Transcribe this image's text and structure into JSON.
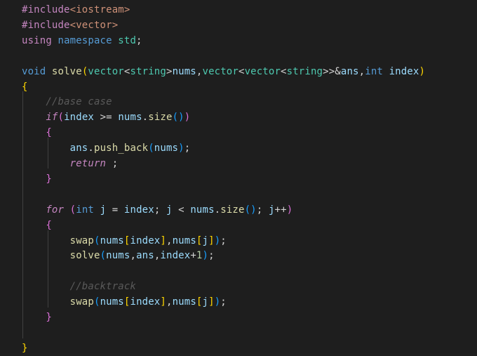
{
  "colors": {
    "background": "#1e1e1e",
    "keyword": "#c586c0",
    "type": "#569cd6",
    "control": "#c586c0",
    "function": "#dcdcaa",
    "variable": "#9cdcfe",
    "comment": "#6a9955",
    "default": "#d4d4d4"
  },
  "lines": [
    [
      {
        "t": "#include",
        "c": "#c586c0"
      },
      {
        "t": "<iostream>",
        "c": "#ce9178"
      }
    ],
    [
      {
        "t": "#include",
        "c": "#c586c0"
      },
      {
        "t": "<vector>",
        "c": "#ce9178"
      }
    ],
    [
      {
        "t": "using ",
        "c": "#c586c0"
      },
      {
        "t": "namespace ",
        "c": "#569cd6"
      },
      {
        "t": "std",
        "c": "#4ec9b0"
      },
      {
        "t": ";",
        "c": "#d4d4d4"
      }
    ],
    [],
    [
      {
        "t": "void ",
        "c": "#569cd6"
      },
      {
        "t": "solve",
        "c": "#dcdcaa"
      },
      {
        "t": "(",
        "c": "#ffd700"
      },
      {
        "t": "vector",
        "c": "#4ec9b0"
      },
      {
        "t": "<",
        "c": "#d4d4d4"
      },
      {
        "t": "string",
        "c": "#4ec9b0"
      },
      {
        "t": ">",
        "c": "#d4d4d4"
      },
      {
        "t": "nums",
        "c": "#9cdcfe"
      },
      {
        "t": ",",
        "c": "#d4d4d4"
      },
      {
        "t": "vector",
        "c": "#4ec9b0"
      },
      {
        "t": "<",
        "c": "#d4d4d4"
      },
      {
        "t": "vector",
        "c": "#4ec9b0"
      },
      {
        "t": "<",
        "c": "#d4d4d4"
      },
      {
        "t": "string",
        "c": "#4ec9b0"
      },
      {
        "t": ">>",
        "c": "#d4d4d4"
      },
      {
        "t": "&",
        "c": "#d4d4d4"
      },
      {
        "t": "ans",
        "c": "#9cdcfe"
      },
      {
        "t": ",",
        "c": "#d4d4d4"
      },
      {
        "t": "int ",
        "c": "#569cd6"
      },
      {
        "t": "index",
        "c": "#9cdcfe"
      },
      {
        "t": ")",
        "c": "#ffd700"
      }
    ],
    [
      {
        "t": "{",
        "c": "#ffd700"
      }
    ],
    [
      {
        "t": "    ",
        "c": "#d4d4d4"
      },
      {
        "t": "//base case",
        "c": "#5a5a5a",
        "i": true
      }
    ],
    [
      {
        "t": "    ",
        "c": "#d4d4d4"
      },
      {
        "t": "if",
        "c": "#c586c0",
        "i": true
      },
      {
        "t": "(",
        "c": "#da70d6"
      },
      {
        "t": "index ",
        "c": "#9cdcfe"
      },
      {
        "t": ">= ",
        "c": "#d4d4d4"
      },
      {
        "t": "nums",
        "c": "#9cdcfe"
      },
      {
        "t": ".",
        "c": "#d4d4d4"
      },
      {
        "t": "size",
        "c": "#dcdcaa"
      },
      {
        "t": "()",
        "c": "#179fff"
      },
      {
        "t": ")",
        "c": "#da70d6"
      }
    ],
    [
      {
        "t": "    ",
        "c": "#d4d4d4"
      },
      {
        "t": "{",
        "c": "#da70d6"
      }
    ],
    [
      {
        "t": "        ",
        "c": "#d4d4d4"
      },
      {
        "t": "ans",
        "c": "#9cdcfe"
      },
      {
        "t": ".",
        "c": "#d4d4d4"
      },
      {
        "t": "push_back",
        "c": "#dcdcaa"
      },
      {
        "t": "(",
        "c": "#179fff"
      },
      {
        "t": "nums",
        "c": "#9cdcfe"
      },
      {
        "t": ")",
        "c": "#179fff"
      },
      {
        "t": ";",
        "c": "#d4d4d4"
      }
    ],
    [
      {
        "t": "        ",
        "c": "#d4d4d4"
      },
      {
        "t": "return ",
        "c": "#c586c0",
        "i": true
      },
      {
        "t": ";",
        "c": "#d4d4d4"
      }
    ],
    [
      {
        "t": "    ",
        "c": "#d4d4d4"
      },
      {
        "t": "}",
        "c": "#da70d6"
      }
    ],
    [],
    [
      {
        "t": "    ",
        "c": "#d4d4d4"
      },
      {
        "t": "for ",
        "c": "#c586c0",
        "i": true
      },
      {
        "t": "(",
        "c": "#da70d6"
      },
      {
        "t": "int ",
        "c": "#569cd6"
      },
      {
        "t": "j ",
        "c": "#9cdcfe"
      },
      {
        "t": "= ",
        "c": "#d4d4d4"
      },
      {
        "t": "index",
        "c": "#9cdcfe"
      },
      {
        "t": "; ",
        "c": "#d4d4d4"
      },
      {
        "t": "j ",
        "c": "#9cdcfe"
      },
      {
        "t": "< ",
        "c": "#d4d4d4"
      },
      {
        "t": "nums",
        "c": "#9cdcfe"
      },
      {
        "t": ".",
        "c": "#d4d4d4"
      },
      {
        "t": "size",
        "c": "#dcdcaa"
      },
      {
        "t": "()",
        "c": "#179fff"
      },
      {
        "t": "; ",
        "c": "#d4d4d4"
      },
      {
        "t": "j",
        "c": "#9cdcfe"
      },
      {
        "t": "++",
        "c": "#d4d4d4"
      },
      {
        "t": ")",
        "c": "#da70d6"
      }
    ],
    [
      {
        "t": "    ",
        "c": "#d4d4d4"
      },
      {
        "t": "{",
        "c": "#da70d6"
      }
    ],
    [
      {
        "t": "        ",
        "c": "#d4d4d4"
      },
      {
        "t": "swap",
        "c": "#dcdcaa"
      },
      {
        "t": "(",
        "c": "#179fff"
      },
      {
        "t": "nums",
        "c": "#9cdcfe"
      },
      {
        "t": "[",
        "c": "#ffd700"
      },
      {
        "t": "index",
        "c": "#9cdcfe"
      },
      {
        "t": "]",
        "c": "#ffd700"
      },
      {
        "t": ",",
        "c": "#d4d4d4"
      },
      {
        "t": "nums",
        "c": "#9cdcfe"
      },
      {
        "t": "[",
        "c": "#ffd700"
      },
      {
        "t": "j",
        "c": "#9cdcfe"
      },
      {
        "t": "]",
        "c": "#ffd700"
      },
      {
        "t": ")",
        "c": "#179fff"
      },
      {
        "t": ";",
        "c": "#d4d4d4"
      }
    ],
    [
      {
        "t": "        ",
        "c": "#d4d4d4"
      },
      {
        "t": "solve",
        "c": "#dcdcaa"
      },
      {
        "t": "(",
        "c": "#179fff"
      },
      {
        "t": "nums",
        "c": "#9cdcfe"
      },
      {
        "t": ",",
        "c": "#d4d4d4"
      },
      {
        "t": "ans",
        "c": "#9cdcfe"
      },
      {
        "t": ",",
        "c": "#d4d4d4"
      },
      {
        "t": "index",
        "c": "#9cdcfe"
      },
      {
        "t": "+",
        "c": "#d4d4d4"
      },
      {
        "t": "1",
        "c": "#b5cea8"
      },
      {
        "t": ")",
        "c": "#179fff"
      },
      {
        "t": ";",
        "c": "#d4d4d4"
      }
    ],
    [],
    [
      {
        "t": "        ",
        "c": "#d4d4d4"
      },
      {
        "t": "//backtrack",
        "c": "#5a5a5a",
        "i": true
      }
    ],
    [
      {
        "t": "        ",
        "c": "#d4d4d4"
      },
      {
        "t": "swap",
        "c": "#dcdcaa"
      },
      {
        "t": "(",
        "c": "#179fff"
      },
      {
        "t": "nums",
        "c": "#9cdcfe"
      },
      {
        "t": "[",
        "c": "#ffd700"
      },
      {
        "t": "index",
        "c": "#9cdcfe"
      },
      {
        "t": "]",
        "c": "#ffd700"
      },
      {
        "t": ",",
        "c": "#d4d4d4"
      },
      {
        "t": "nums",
        "c": "#9cdcfe"
      },
      {
        "t": "[",
        "c": "#ffd700"
      },
      {
        "t": "j",
        "c": "#9cdcfe"
      },
      {
        "t": "]",
        "c": "#ffd700"
      },
      {
        "t": ")",
        "c": "#179fff"
      },
      {
        "t": ";",
        "c": "#d4d4d4"
      }
    ],
    [
      {
        "t": "    ",
        "c": "#d4d4d4"
      },
      {
        "t": "}",
        "c": "#da70d6"
      }
    ],
    [],
    [
      {
        "t": "}",
        "c": "#ffd700"
      }
    ]
  ]
}
